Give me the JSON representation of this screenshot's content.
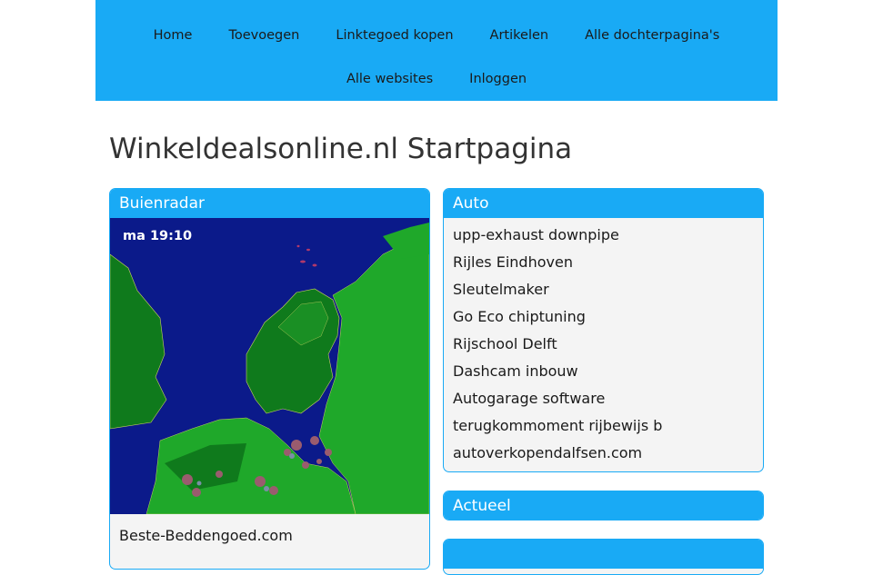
{
  "nav": {
    "row1": [
      "Home",
      "Toevoegen",
      "Linktegoed kopen",
      "Artikelen",
      "Alle dochterpagina's"
    ],
    "row2": [
      "Alle websites",
      "Inloggen"
    ]
  },
  "page": {
    "title": "Winkeldealsonline.nl Startpagina"
  },
  "radar": {
    "header": "Buienradar",
    "time_label": "ma 19:10",
    "link": "Beste-Beddengoed.com"
  },
  "auto": {
    "header": "Auto",
    "links": [
      "upp-exhaust downpipe",
      "Rijles Eindhoven",
      "Sleutelmaker",
      "Go Eco chiptuning",
      "Rijschool Delft",
      "Dashcam inbouw",
      "Autogarage software",
      "terugkommoment rijbewijs b",
      "autoverkopendalfsen.com"
    ]
  },
  "actueel": {
    "header": "Actueel"
  },
  "colors": {
    "accent": "#19aaf5",
    "sea": "#0b1a8a",
    "land": "#1fa82a",
    "land_dark": "#0f7a1c",
    "rain": "#9a5c6e"
  }
}
